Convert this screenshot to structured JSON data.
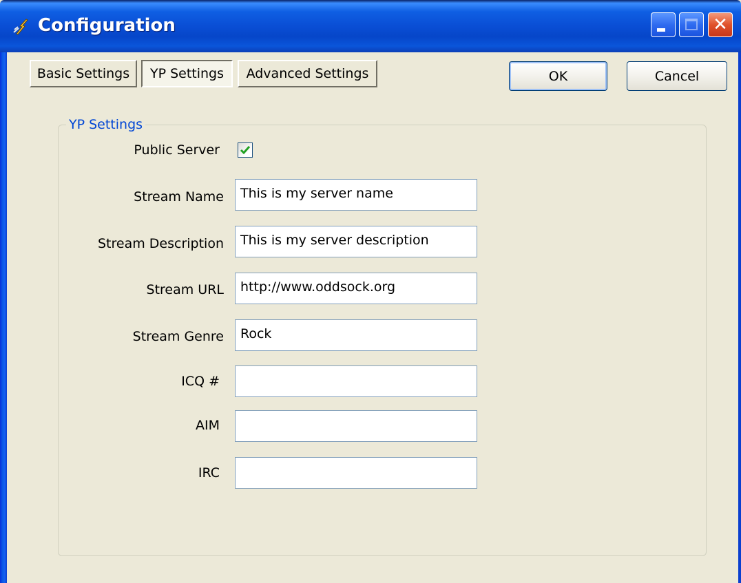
{
  "window": {
    "title": "Configuration",
    "controls": {
      "minimize": "minimize",
      "maximize": "maximize",
      "close": "✕"
    }
  },
  "tabs": [
    {
      "label": "Basic Settings",
      "active": false
    },
    {
      "label": "YP Settings",
      "active": true
    },
    {
      "label": "Advanced Settings",
      "active": false
    }
  ],
  "buttons": {
    "ok": "OK",
    "cancel": "Cancel"
  },
  "group": {
    "legend": "YP Settings"
  },
  "fields": {
    "public_server": {
      "label": "Public Server",
      "checked": true
    },
    "stream_name": {
      "label": "Stream Name",
      "value": "This is my server name"
    },
    "stream_description": {
      "label": "Stream Description",
      "value": "This is my server description"
    },
    "stream_url": {
      "label": "Stream URL",
      "value": "http://www.oddsock.org"
    },
    "stream_genre": {
      "label": "Stream Genre",
      "value": "Rock"
    },
    "icq": {
      "label": "ICQ #",
      "value": ""
    },
    "aim": {
      "label": "AIM",
      "value": ""
    },
    "irc": {
      "label": "IRC",
      "value": ""
    }
  },
  "icons": {
    "app": "lightning-bolt-icon",
    "check": "checkmark-icon"
  },
  "colors": {
    "titlebar": "#0A4FD6",
    "group_legend": "#0046D5",
    "dialog_bg": "#ECE9D8",
    "close_button": "#E0522B"
  }
}
